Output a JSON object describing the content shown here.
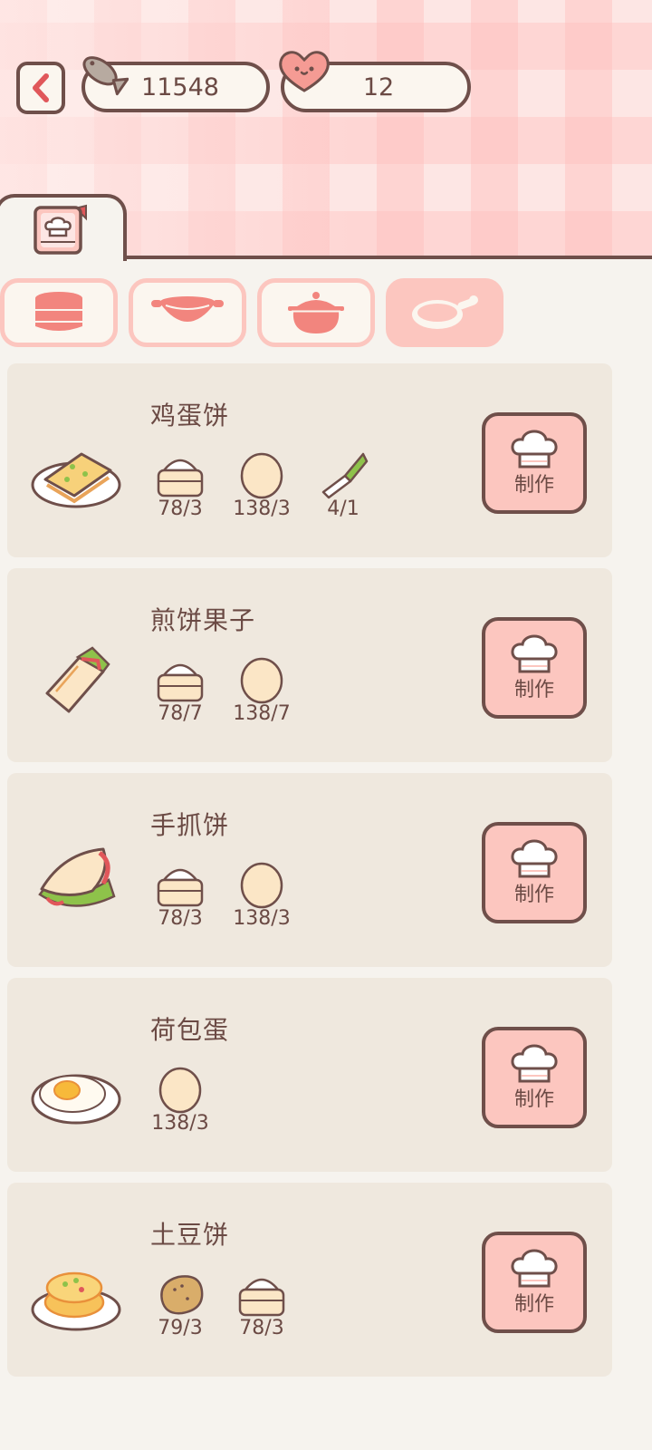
{
  "header": {
    "fish_count": "11548",
    "heart_count": "12"
  },
  "tabs": {
    "active_icon": "recipe-book-icon"
  },
  "categories": [
    {
      "icon": "steamer-icon",
      "selected": false
    },
    {
      "icon": "wok-icon",
      "selected": false
    },
    {
      "icon": "clay-pot-icon",
      "selected": false
    },
    {
      "icon": "frying-pan-icon",
      "selected": true
    }
  ],
  "recipes": [
    {
      "name": "鸡蛋饼",
      "make_label": "制作",
      "ingredients": [
        {
          "icon": "flour-steamer-icon",
          "count": "78/3"
        },
        {
          "icon": "egg-icon",
          "count": "138/3"
        },
        {
          "icon": "scallion-icon",
          "count": "4/1"
        }
      ]
    },
    {
      "name": "煎饼果子",
      "make_label": "制作",
      "ingredients": [
        {
          "icon": "flour-steamer-icon",
          "count": "78/7"
        },
        {
          "icon": "egg-icon",
          "count": "138/7"
        }
      ]
    },
    {
      "name": "手抓饼",
      "make_label": "制作",
      "ingredients": [
        {
          "icon": "flour-steamer-icon",
          "count": "78/3"
        },
        {
          "icon": "egg-icon",
          "count": "138/3"
        }
      ]
    },
    {
      "name": "荷包蛋",
      "make_label": "制作",
      "ingredients": [
        {
          "icon": "egg-icon",
          "count": "138/3"
        }
      ]
    },
    {
      "name": "土豆饼",
      "make_label": "制作",
      "ingredients": [
        {
          "icon": "potato-icon",
          "count": "79/3"
        },
        {
          "icon": "flour-steamer-icon",
          "count": "78/3"
        }
      ]
    }
  ],
  "colors": {
    "outline": "#6f4f4a",
    "accent_pink": "#fcc6bf",
    "card_bg": "#efe8de",
    "page_bg": "#f6f3ee"
  }
}
